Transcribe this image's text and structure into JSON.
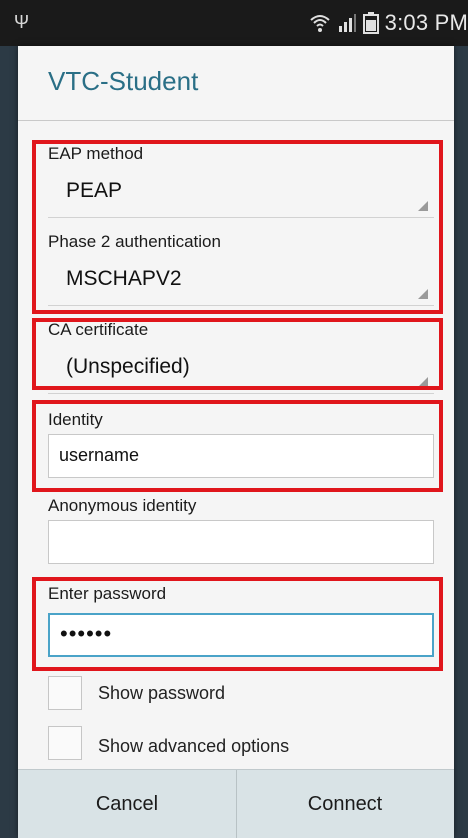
{
  "status_bar": {
    "time": "3:03 PM",
    "icons": [
      "usb-icon",
      "wifi-icon",
      "signal-icon",
      "battery-icon"
    ]
  },
  "dialog": {
    "title": "VTC-Student",
    "eap_method": {
      "label": "EAP method",
      "value": "PEAP"
    },
    "phase2": {
      "label": "Phase 2 authentication",
      "value": "MSCHAPV2"
    },
    "ca_certificate": {
      "label": "CA certificate",
      "value": "(Unspecified)"
    },
    "identity": {
      "label": "Identity",
      "value": "username"
    },
    "anonymous_identity": {
      "label": "Anonymous identity",
      "value": ""
    },
    "password": {
      "label": "Enter password",
      "value": "••••••"
    },
    "show_password": {
      "label": "Show password",
      "checked": false
    },
    "show_advanced": {
      "label": "Show advanced options",
      "checked": false
    },
    "buttons": {
      "cancel": "Cancel",
      "connect": "Connect"
    }
  },
  "colors": {
    "title": "#2a6f86",
    "highlight": "#e0161c",
    "focus": "#4aa3c8",
    "button_bar": "#d9e3e6"
  }
}
